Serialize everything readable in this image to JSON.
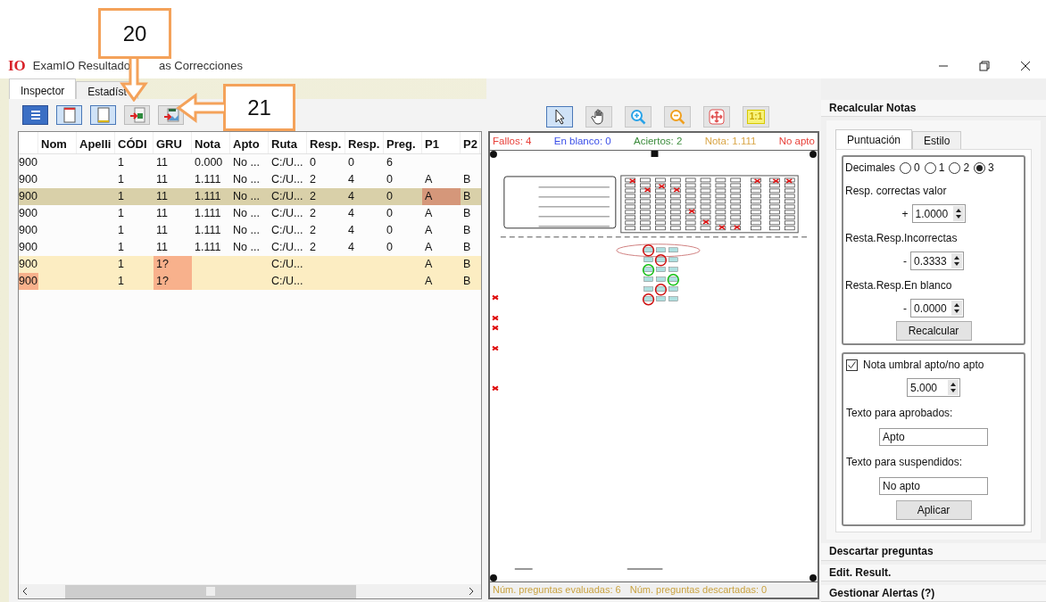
{
  "window": {
    "logo": "IO",
    "title": "ExamIO Resultado",
    "title_tail": "as Correcciones"
  },
  "callouts": [
    {
      "label": "20",
      "kind": "down"
    },
    {
      "label": "21",
      "kind": "left"
    }
  ],
  "left_tabs": [
    {
      "label": "Inspector",
      "selected": true
    },
    {
      "label": "Estadíst",
      "selected": false
    }
  ],
  "left_toolbar": [
    {
      "kind": "list",
      "selected": true
    },
    {
      "kind": "page-top",
      "selected": false
    },
    {
      "kind": "page-bottom",
      "selected": false
    },
    {
      "kind": "export-sheet",
      "selected": false
    },
    {
      "kind": "export-image",
      "selected": false
    }
  ],
  "table": {
    "columns": [
      "",
      "Nom",
      "Apelli",
      "CÓDI",
      "GRU",
      "Nota",
      "Apto",
      "Ruta",
      "Resp.",
      "Resp.",
      "Preg.",
      "P1",
      "P2"
    ],
    "rows": [
      {
        "selected": false,
        "incomplete": false,
        "cells": [
          {
            "text": "900",
            "flagged": false
          },
          {
            "flagged": false
          },
          {
            "flagged": false
          },
          {
            "text": "1",
            "flagged": false
          },
          {
            "text": "11",
            "flagged": false
          },
          {
            "text": "0.000",
            "flagged": false
          },
          {
            "text": "No ...",
            "flagged": false
          },
          {
            "text": "C:/U...",
            "flagged": false
          },
          {
            "text": "0",
            "flagged": false
          },
          {
            "text": "0",
            "flagged": false
          },
          {
            "text": "6",
            "flagged": false
          },
          {
            "flagged": false
          },
          {
            "flagged": false
          }
        ]
      },
      {
        "selected": false,
        "incomplete": false,
        "cells": [
          {
            "text": "900",
            "flagged": false
          },
          {
            "flagged": false
          },
          {
            "flagged": false
          },
          {
            "text": "1",
            "flagged": false
          },
          {
            "text": "11",
            "flagged": false
          },
          {
            "text": "1.111",
            "flagged": false
          },
          {
            "text": "No ...",
            "flagged": false
          },
          {
            "text": "C:/U...",
            "flagged": false
          },
          {
            "text": "2",
            "flagged": false
          },
          {
            "text": "4",
            "flagged": false
          },
          {
            "text": "0",
            "flagged": false
          },
          {
            "text": "A",
            "flagged": false
          },
          {
            "text": "B",
            "flagged": false
          }
        ]
      },
      {
        "selected": true,
        "incomplete": false,
        "cells": [
          {
            "text": "900",
            "flagged": false
          },
          {
            "flagged": false
          },
          {
            "flagged": false
          },
          {
            "text": "1",
            "flagged": false
          },
          {
            "text": "11",
            "flagged": false
          },
          {
            "text": "1.111",
            "flagged": false
          },
          {
            "text": "No ...",
            "flagged": false
          },
          {
            "text": "C:/U...",
            "flagged": false
          },
          {
            "text": "2",
            "flagged": false
          },
          {
            "text": "4",
            "flagged": false
          },
          {
            "text": "0",
            "flagged": false
          },
          {
            "text": "A",
            "flagged": true
          },
          {
            "text": "B",
            "flagged": false
          }
        ]
      },
      {
        "selected": false,
        "incomplete": false,
        "cells": [
          {
            "text": "900",
            "flagged": false
          },
          {
            "flagged": false
          },
          {
            "flagged": false
          },
          {
            "text": "1",
            "flagged": false
          },
          {
            "text": "11",
            "flagged": false
          },
          {
            "text": "1.111",
            "flagged": false
          },
          {
            "text": "No ...",
            "flagged": false
          },
          {
            "text": "C:/U...",
            "flagged": false
          },
          {
            "text": "2",
            "flagged": false
          },
          {
            "text": "4",
            "flagged": false
          },
          {
            "text": "0",
            "flagged": false
          },
          {
            "text": "A",
            "flagged": false
          },
          {
            "text": "B",
            "flagged": false
          }
        ]
      },
      {
        "selected": false,
        "incomplete": false,
        "cells": [
          {
            "text": "900",
            "flagged": false
          },
          {
            "flagged": false
          },
          {
            "flagged": false
          },
          {
            "text": "1",
            "flagged": false
          },
          {
            "text": "11",
            "flagged": false
          },
          {
            "text": "1.111",
            "flagged": false
          },
          {
            "text": "No ...",
            "flagged": false
          },
          {
            "text": "C:/U...",
            "flagged": false
          },
          {
            "text": "2",
            "flagged": false
          },
          {
            "text": "4",
            "flagged": false
          },
          {
            "text": "0",
            "flagged": false
          },
          {
            "text": "A",
            "flagged": false
          },
          {
            "text": "B",
            "flagged": false
          }
        ]
      },
      {
        "selected": false,
        "incomplete": false,
        "cells": [
          {
            "text": "900",
            "flagged": false
          },
          {
            "flagged": false
          },
          {
            "flagged": false
          },
          {
            "text": "1",
            "flagged": false
          },
          {
            "text": "11",
            "flagged": false
          },
          {
            "text": "1.111",
            "flagged": false
          },
          {
            "text": "No ...",
            "flagged": false
          },
          {
            "text": "C:/U...",
            "flagged": false
          },
          {
            "text": "2",
            "flagged": false
          },
          {
            "text": "4",
            "flagged": false
          },
          {
            "text": "0",
            "flagged": false
          },
          {
            "text": "A",
            "flagged": false
          },
          {
            "text": "B",
            "flagged": false
          }
        ]
      },
      {
        "selected": false,
        "incomplete": true,
        "cells": [
          {
            "text": "900",
            "flagged": false
          },
          {
            "flagged": false
          },
          {
            "flagged": false
          },
          {
            "text": "1",
            "flagged": false
          },
          {
            "text": "1?",
            "flagged": true
          },
          {
            "flagged": false
          },
          {
            "flagged": false
          },
          {
            "text": "C:/U...",
            "flagged": false
          },
          {
            "flagged": false
          },
          {
            "flagged": false
          },
          {
            "flagged": false
          },
          {
            "text": "A",
            "flagged": false
          },
          {
            "text": "B",
            "flagged": false
          }
        ]
      },
      {
        "selected": false,
        "incomplete": true,
        "cells": [
          {
            "text": "900",
            "flagged": true
          },
          {
            "flagged": false
          },
          {
            "flagged": false
          },
          {
            "text": "1",
            "flagged": false
          },
          {
            "text": "1?",
            "flagged": true
          },
          {
            "flagged": false
          },
          {
            "flagged": false
          },
          {
            "text": "C:/U...",
            "flagged": false
          },
          {
            "flagged": false
          },
          {
            "flagged": false
          },
          {
            "flagged": false
          },
          {
            "text": "A",
            "flagged": false
          },
          {
            "text": "B",
            "flagged": false
          }
        ]
      }
    ]
  },
  "viewer_toolbar": [
    {
      "kind": "pointer",
      "selected": true
    },
    {
      "kind": "hand",
      "selected": false
    },
    {
      "kind": "zoom-in",
      "selected": false
    },
    {
      "kind": "zoom-out",
      "selected": false
    },
    {
      "kind": "fit",
      "selected": false
    },
    {
      "kind": "actual-size",
      "label": "1:1",
      "selected": false
    }
  ],
  "viewer": {
    "stats": [
      {
        "text": "Fallos: 4",
        "color": "#e8413a"
      },
      {
        "text": "En blanco: 0",
        "color": "#3a4fe8"
      },
      {
        "text": "Aciertos: 2",
        "color": "#3c8c3c"
      },
      {
        "text": "Nota: 1.111",
        "color": "#d9a545"
      },
      {
        "text": "No apto",
        "color": "#e8413a"
      }
    ],
    "status": [
      "Núm. preguntas evaluadas: 6",
      "Núm. preguntas descartadas: 0"
    ]
  },
  "right_panel": {
    "header": "Recalcular Notas",
    "tabs": [
      {
        "label": "Puntuación",
        "selected": true
      },
      {
        "label": "Estilo",
        "selected": false
      }
    ],
    "decimals": {
      "label": "Decimales",
      "options": [
        {
          "label": "0",
          "selected": false
        },
        {
          "label": "1",
          "selected": false
        },
        {
          "label": "2",
          "selected": false
        },
        {
          "label": "3",
          "selected": true
        }
      ]
    },
    "values": [
      {
        "label": "Resp. correctas valor",
        "sign": "+",
        "value": "1.0000"
      },
      {
        "label": "Resta.Resp.Incorrectas",
        "sign": "-",
        "value": "0.3333"
      },
      {
        "label": "Resta.Resp.En blanco",
        "sign": "-",
        "value": "0.0000"
      }
    ],
    "recalc_button": "Recalcular",
    "threshold": {
      "label": "Nota umbral apto/no apto",
      "checked": true,
      "value": "5.000"
    },
    "texts": [
      {
        "label": "Texto para aprobados:",
        "value": "Apto"
      },
      {
        "label": "Texto para suspendidos:",
        "value": "No apto"
      }
    ],
    "apply_button": "Aplicar",
    "sections": [
      "Descartar preguntas",
      "Edit. Result.",
      "Gestionar Alertas (?)"
    ]
  }
}
